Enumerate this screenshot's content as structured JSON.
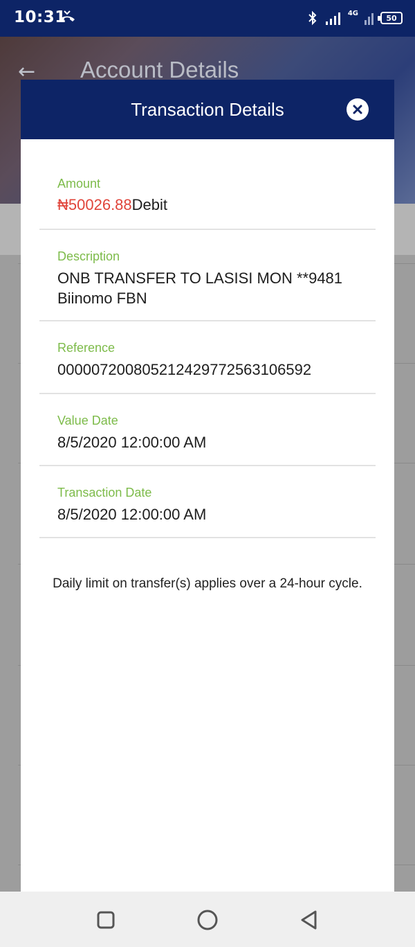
{
  "status_bar": {
    "time": "10:31",
    "network": "4G",
    "battery": "50"
  },
  "background": {
    "title": "Account Details"
  },
  "modal": {
    "title": "Transaction Details",
    "fields": [
      {
        "label": "Amount",
        "value_amount": "₦50026.88",
        "value_type": "Debit"
      },
      {
        "label": "Description",
        "value": "ONB TRANSFER TO LASISI MON **9481 Biinomo FBN"
      },
      {
        "label": "Reference",
        "value": "000007200805212429772563106592"
      },
      {
        "label": "Value Date",
        "value": "8/5/2020 12:00:00 AM"
      },
      {
        "label": "Transaction Date",
        "value": "8/5/2020 12:00:00 AM"
      }
    ],
    "note": "Daily limit on transfer(s) applies over a 24-hour cycle."
  },
  "colors": {
    "primary": "#0d2466",
    "label_green": "#7dbb4a",
    "amount_red": "#e0443a"
  },
  "icons": {
    "close": "close-icon",
    "back": "back-arrow-icon",
    "nav_recent": "square-icon",
    "nav_home": "circle-icon",
    "nav_back": "triangle-back-icon"
  }
}
